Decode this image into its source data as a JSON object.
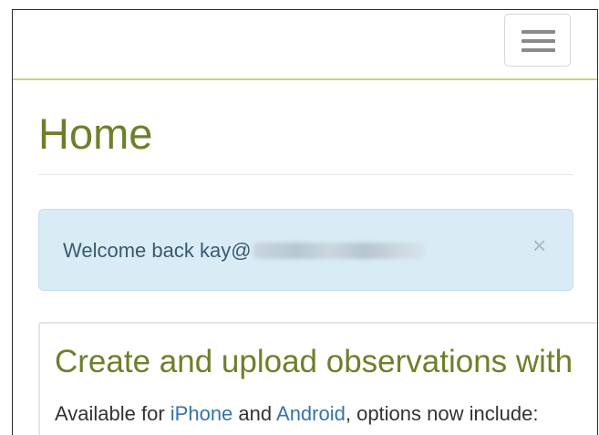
{
  "navbar": {
    "menu_icon": "hamburger-menu-icon"
  },
  "page": {
    "title": "Home"
  },
  "alert": {
    "welcome_prefix": "Welcome back kay@",
    "close_label": "×",
    "colors": {
      "background": "#d9ecf6",
      "text": "#3a5a6e"
    }
  },
  "panel": {
    "title": "Create and upload observations with",
    "text_prefix": "Available for ",
    "link_iphone": "iPhone",
    "text_and": " and ",
    "link_android": "Android",
    "text_suffix": ", options now include:"
  },
  "colors": {
    "accent": "#6e7f2a",
    "link": "#3673a8",
    "navbar_border": "#c7d48a"
  }
}
